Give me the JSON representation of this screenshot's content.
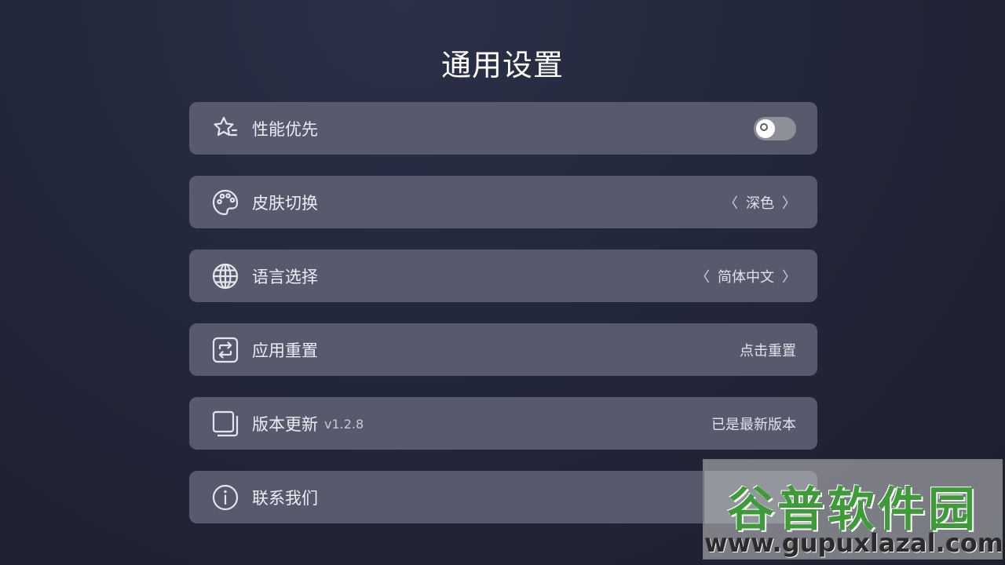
{
  "page": {
    "title": "通用设置"
  },
  "settings": [
    {
      "icon": "star-icon",
      "label": "性能优先",
      "control": "toggle",
      "enabled": false
    },
    {
      "icon": "palette-icon",
      "label": "皮肤切换",
      "control": "selector",
      "value": "深色",
      "prev": "〈",
      "next": "〉"
    },
    {
      "icon": "globe-icon",
      "label": "语言选择",
      "control": "selector",
      "value": "简体中文",
      "prev": "〈",
      "next": "〉"
    },
    {
      "icon": "reset-icon",
      "label": "应用重置",
      "control": "action",
      "value": "点击重置"
    },
    {
      "icon": "copy-icon",
      "label": "版本更新",
      "sub": "v1.2.8",
      "control": "status",
      "value": "已是最新版本"
    },
    {
      "icon": "info-icon",
      "label": "联系我们",
      "control": "none"
    }
  ],
  "watermark": {
    "name": "谷普软件园",
    "url": "www.gupuxlazal.com"
  },
  "colors": {
    "row_bg": "#565a6c",
    "watermark_green": "#3f9a3a"
  }
}
